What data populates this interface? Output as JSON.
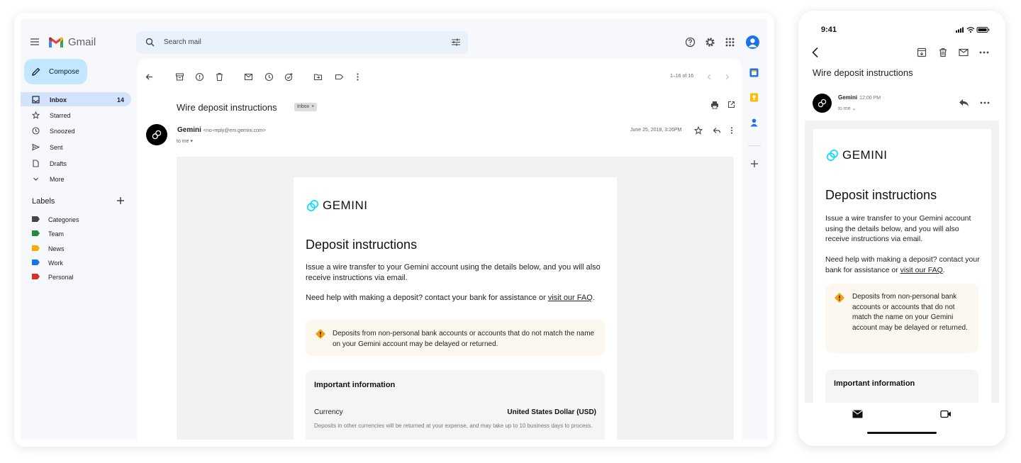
{
  "desktop": {
    "app_name": "Gmail",
    "search_placeholder": "Search mail",
    "compose_label": "Compose",
    "nav": [
      {
        "label": "Inbox",
        "count": "14"
      },
      {
        "label": "Starred"
      },
      {
        "label": "Snoozed"
      },
      {
        "label": "Sent"
      },
      {
        "label": "Drafts"
      },
      {
        "label": "More"
      }
    ],
    "labels_heading": "Labels",
    "labels": [
      {
        "name": "Categories",
        "color": "#444746"
      },
      {
        "name": "Team",
        "color": "#1e8e3e"
      },
      {
        "name": "News",
        "color": "#f9ab00"
      },
      {
        "name": "Work",
        "color": "#1a73e8"
      },
      {
        "name": "Personal",
        "color": "#d93025"
      }
    ],
    "pager": "1–16 of 16",
    "subject": "Wire deposit instructions",
    "chip_label": "Inbox",
    "sender_name": "Gemini",
    "sender_email": "<no-reply@em.gemini.com>",
    "to_me": "to me",
    "date": "June 25, 2018, 3:26PM"
  },
  "email": {
    "brand": "GEMINI",
    "title": "Deposit instructions",
    "para1": "Issue a wire transfer to your Gemini account using the details below, and you will also receive instructions via email.",
    "para2_prefix": "Need help with making a deposit? contact your bank for assistance or ",
    "para2_link": "visit our FAQ",
    "para2_suffix": ".",
    "warning": "Deposits from non-personal bank accounts or accounts that do not match the name on your Gemini account may be delayed or returned.",
    "info_title": "Important information",
    "currency_label": "Currency",
    "currency_value": "United States Dollar (USD)",
    "currency_note": "Deposits in other currencies will be returned at your expense, and may take up to 10 business days to process."
  },
  "mobile": {
    "clock": "9:41",
    "subject": "Wire deposit instructions",
    "sender_name": "Gemini",
    "sender_time": "12:00 PM",
    "to_me": "to me"
  },
  "colors": {
    "accent": "#1a73e8",
    "gemini": "#00dcfa",
    "warning": "#f59e0b"
  }
}
